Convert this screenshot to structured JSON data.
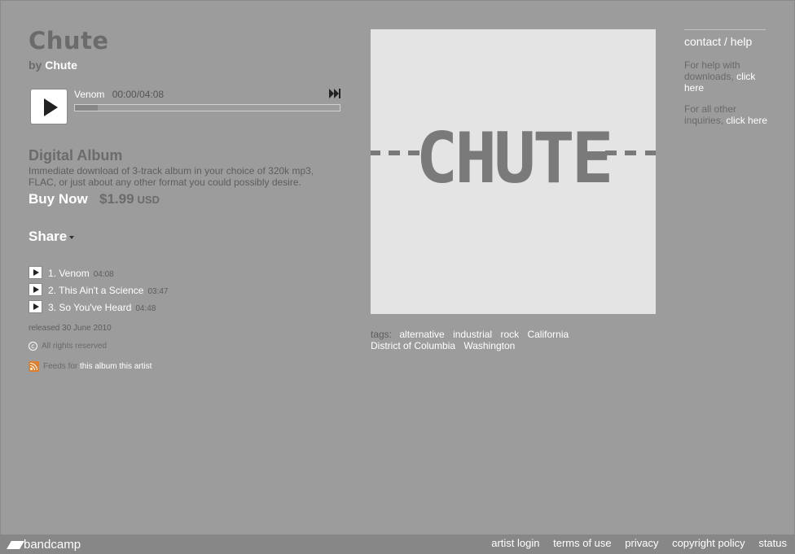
{
  "album": {
    "title": "Chute",
    "by_prefix": "by",
    "artist": "Chute"
  },
  "player": {
    "track_name": "Venom",
    "time": "00:00/04:08",
    "progress_fraction": 0.0
  },
  "purchase": {
    "format_title": "Digital Album",
    "description": "Immediate download of 3-track album in your choice of 320k mp3, FLAC, or just about any other format you could possibly desire.",
    "buy_label": "Buy Now",
    "price": "$1.99",
    "currency": "USD"
  },
  "share": {
    "label": "Share"
  },
  "tracks": [
    {
      "title": "1. Venom",
      "duration": "04:08"
    },
    {
      "title": "2. This Ain't a Science",
      "duration": "03:47"
    },
    {
      "title": "3. So You've Heard",
      "duration": "04:48"
    }
  ],
  "meta": {
    "released": "released 30 June 2010",
    "rights": "All rights reserved",
    "feeds_prefix": "Feeds for",
    "feeds_album": "this album",
    "feeds_artist": "this artist"
  },
  "artwork": {
    "logo_text": "CHUTE"
  },
  "tags": {
    "label": "tags:",
    "items": [
      "alternative",
      "industrial",
      "rock",
      "California",
      "District of Columbia",
      "Washington"
    ]
  },
  "sidebar": {
    "contact": "contact / help",
    "help_downloads_text": "For help with downloads,",
    "help_downloads_link": "click here",
    "help_other_text": "For all other inquiries,",
    "help_other_link": "click here"
  },
  "footer": {
    "logo": "bandcamp",
    "links": [
      "artist login",
      "terms of use",
      "privacy",
      "copyright policy",
      "status"
    ]
  },
  "colors": {
    "background": "#9c9c9c",
    "footer": "#878787",
    "link": "#ffffff",
    "muted_text": "#6b6b6b",
    "artwork_bg": "#e4e4e4",
    "rss": "#e07f2b"
  }
}
